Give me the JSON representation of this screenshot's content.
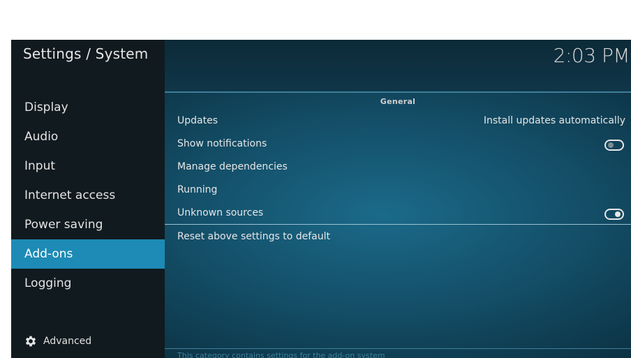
{
  "header": {
    "section_title": "Settings / System",
    "clock": "2:03 PM"
  },
  "sidebar": {
    "items": [
      {
        "label": "Display"
      },
      {
        "label": "Audio"
      },
      {
        "label": "Input"
      },
      {
        "label": "Internet access"
      },
      {
        "label": "Power saving"
      },
      {
        "label": "Add-ons",
        "active": true
      },
      {
        "label": "Logging"
      }
    ],
    "advanced_label": "Advanced",
    "active_color": "#1d8bb5"
  },
  "content": {
    "group_label": "General",
    "settings": [
      {
        "label": "Updates",
        "value": "Install updates automatically"
      },
      {
        "label": "Show notifications",
        "toggle": "off"
      },
      {
        "label": "Manage dependencies"
      },
      {
        "label": "Running"
      },
      {
        "label": "Unknown sources",
        "toggle": "on"
      }
    ],
    "reset_label": "Reset above settings to default",
    "hint": "This category contains settings for the add-on system"
  },
  "icons": {
    "advanced": "gear-icon",
    "toggle": "toggle-switch-icon"
  }
}
